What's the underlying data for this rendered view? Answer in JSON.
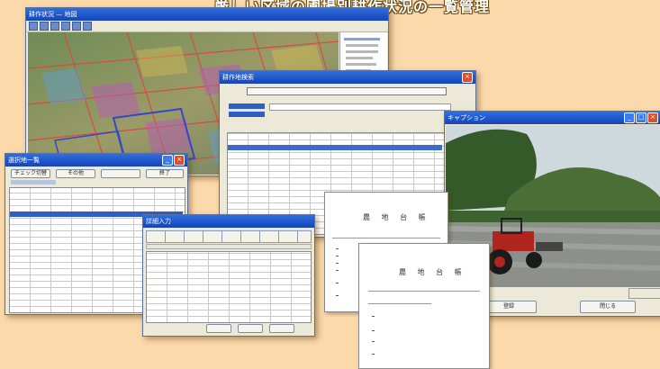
{
  "headline": "厳しい区域の圃場別耕作状況の一覧管理",
  "windows": {
    "map": {
      "title": "耕作状況 — 地図"
    },
    "search": {
      "title": "耕作地検索"
    },
    "table": {
      "title": "選択地一覧",
      "tab_check": "チェック切替",
      "tab_other": "その他",
      "tab_close": "終了"
    },
    "form": {
      "title": "詳細入力"
    },
    "photo": {
      "title": "キャプション",
      "btn_register": "登録",
      "btn_close": "閉じる"
    }
  },
  "documents": {
    "doc1_title": "農 地 台 帳",
    "doc2_title": "農 地 台 帳"
  },
  "colors": {
    "accent": "#1543b8",
    "background": "#fbd9ab"
  }
}
